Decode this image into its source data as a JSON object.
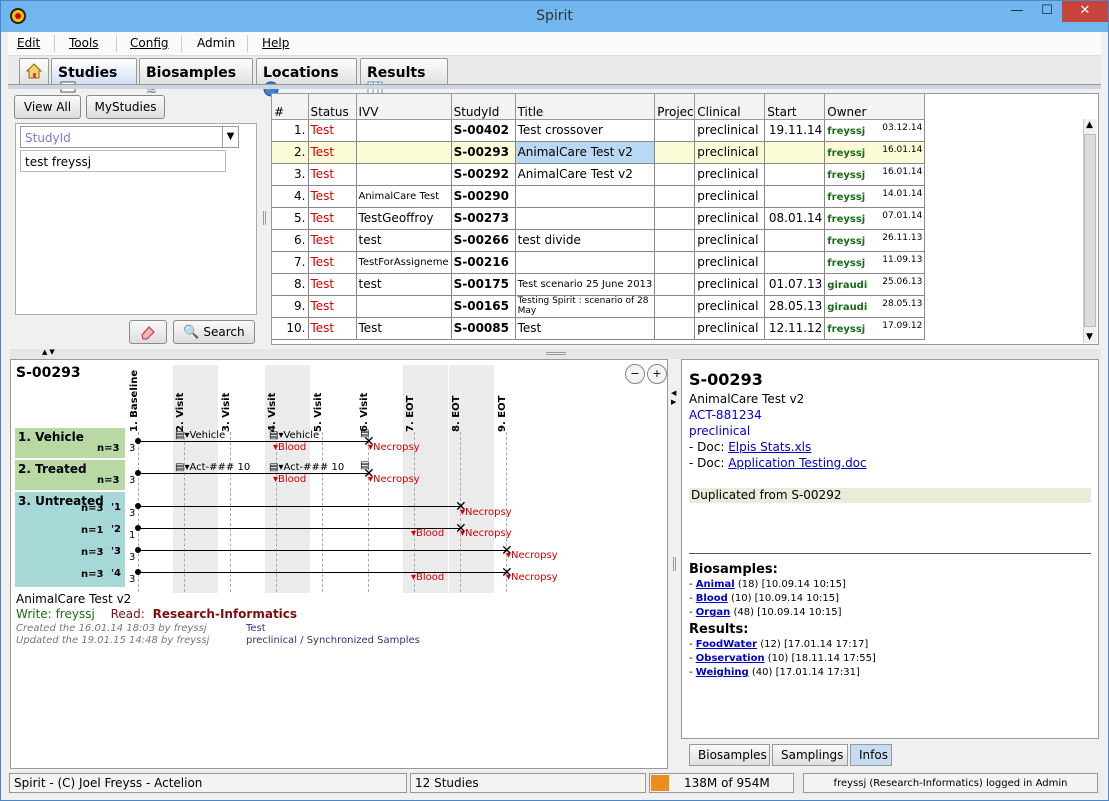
{
  "window": {
    "title": "Spirit",
    "controls": {
      "minimize": "—",
      "maximize": "☐",
      "close": "✕"
    }
  },
  "menu": [
    "Edit",
    "Tools",
    "Config",
    "Admin",
    "Help"
  ],
  "tabs": [
    {
      "label": "Studies",
      "icon": "studies-card-icon",
      "selected": true
    },
    {
      "label": "Biosamples",
      "icon": "dna-icon"
    },
    {
      "label": "Locations",
      "icon": "globe-icon"
    },
    {
      "label": "Results",
      "icon": "grid-icon"
    }
  ],
  "left": {
    "view_all": "View All",
    "my_studies": "MyStudies",
    "studyid_placeholder": "StudyId",
    "user_value": "test freyssj",
    "search": "Search"
  },
  "table": {
    "headers": [
      "#",
      "Status",
      "IVV",
      "StudyId",
      "Title",
      "Project",
      "Clinical",
      "Start",
      "Owner"
    ],
    "rows": [
      {
        "n": "1.",
        "status": "Test",
        "ivv": "",
        "id": "S-00402",
        "title": "Test crossover",
        "project": "",
        "clinical": "preclinical",
        "start": "19.11.14",
        "owner": "freyssj",
        "date": "03.12.14"
      },
      {
        "n": "2.",
        "status": "Test",
        "ivv": "",
        "id": "S-00293",
        "title": "AnimalCare Test v2",
        "project": "",
        "clinical": "preclinical",
        "start": "",
        "owner": "freyssj",
        "date": "16.01.14"
      },
      {
        "n": "3.",
        "status": "Test",
        "ivv": "",
        "id": "S-00292",
        "title": "AnimalCare Test v2",
        "project": "",
        "clinical": "preclinical",
        "start": "",
        "owner": "freyssj",
        "date": "16.01.14"
      },
      {
        "n": "4.",
        "status": "Test",
        "ivv": "AnimalCare Test",
        "id": "S-00290",
        "title": "",
        "project": "",
        "clinical": "preclinical",
        "start": "",
        "owner": "freyssj",
        "date": "14.01.14"
      },
      {
        "n": "5.",
        "status": "Test",
        "ivv": "TestGeoffroy",
        "id": "S-00273",
        "title": "",
        "project": "",
        "clinical": "preclinical",
        "start": "08.01.14",
        "owner": "freyssj",
        "date": "07.01.14"
      },
      {
        "n": "6.",
        "status": "Test",
        "ivv": "test",
        "id": "S-00266",
        "title": "test divide",
        "project": "",
        "clinical": "preclinical",
        "start": "",
        "owner": "freyssj",
        "date": "26.11.13"
      },
      {
        "n": "7.",
        "status": "Test",
        "ivv": "TestForAssigneme",
        "id": "S-00216",
        "title": "",
        "project": "",
        "clinical": "preclinical",
        "start": "",
        "owner": "freyssj",
        "date": "11.09.13"
      },
      {
        "n": "8.",
        "status": "Test",
        "ivv": "test",
        "id": "S-00175",
        "title": "Test scenario 25 June 2013",
        "project": "",
        "clinical": "preclinical",
        "start": "01.07.13",
        "owner": "giraudi",
        "date": "25.06.13"
      },
      {
        "n": "9.",
        "status": "Test",
        "ivv": "",
        "id": "S-00165",
        "title": "Testing Spirit : scenario of 28 May",
        "project": "",
        "clinical": "preclinical",
        "start": "28.05.13",
        "owner": "giraudi",
        "date": "28.05.13"
      },
      {
        "n": "10.",
        "status": "Test",
        "ivv": "Test",
        "id": "S-00085",
        "title": "Test",
        "project": "",
        "clinical": "preclinical",
        "start": "12.11.12",
        "owner": "freyssj",
        "date": "17.09.12"
      }
    ]
  },
  "design": {
    "study_id": "S-00293",
    "phases": [
      "1. Baseline",
      "2. Visit",
      "3. Visit",
      "4. Visit",
      "5. Visit",
      "6. Visit",
      "7. EOT",
      "8. EOT",
      "9. EOT"
    ],
    "groups": [
      {
        "name": "1. Vehicle",
        "n": "n=3",
        "color": "#b8d9a4"
      },
      {
        "name": "2. Treated",
        "n": "n=3",
        "color": "#b8d9a4"
      },
      {
        "name": "3. Untreated",
        "color": "#a7d8d8",
        "subgroups": [
          {
            "n": "n=3",
            "label": "'1"
          },
          {
            "n": "n=1",
            "label": "'2"
          },
          {
            "n": "n=3",
            "label": "'3"
          },
          {
            "n": "n=3",
            "label": "'4"
          }
        ]
      }
    ],
    "labels": {
      "vehicle": "Vehicle",
      "act": "Act-### 10",
      "blood": "Blood",
      "necropsy": "Necropsy",
      "three": "3",
      "one": "1"
    },
    "footer": {
      "title": "AnimalCare Test v2",
      "write_label": "Write:",
      "write_value": "freyssj",
      "read_label": "Read:",
      "read_value": "Research-Informatics",
      "created": "Created the 16.01.14 18:03 by freyssj",
      "updated": "Updated the 19.01.15 14:48 by freyssj",
      "status": "Test",
      "type": "preclinical / Synchronized Samples"
    }
  },
  "info": {
    "study_id": "S-00293",
    "title": "AnimalCare Test v2",
    "act": "ACT-881234",
    "clinical": "preclinical",
    "doc_prefix": "- Doc:",
    "docs": [
      "Elpis Stats.xls",
      "Application Testing.doc"
    ],
    "duplicated": "Duplicated from S-00292",
    "biosamples_heading": "Biosamples:",
    "biosamples": [
      {
        "name": "Animal",
        "count": "(18)",
        "date": "[10.09.14 10:15]"
      },
      {
        "name": "Blood",
        "count": "(10)",
        "date": "[10.09.14 10:15]"
      },
      {
        "name": "Organ",
        "count": "(48)",
        "date": "[10.09.14 10:15]"
      }
    ],
    "results_heading": "Results:",
    "results": [
      {
        "name": "FoodWater",
        "count": "(12)",
        "date": "[17.01.14 17:17]"
      },
      {
        "name": "Observation",
        "count": "(10)",
        "date": "[18.11.14 17:55]"
      },
      {
        "name": "Weighing",
        "count": "(40)",
        "date": "[17.01.14 17:31]"
      }
    ]
  },
  "bottom_tabs": [
    "Biosamples",
    "Samplings",
    "Infos"
  ],
  "status": {
    "copyright": "Spirit - (C) Joel Freyss - Actelion",
    "count": "12 Studies",
    "memory": "138M of 954M",
    "user": "freyssj (Research-Informatics) logged in Admin"
  }
}
